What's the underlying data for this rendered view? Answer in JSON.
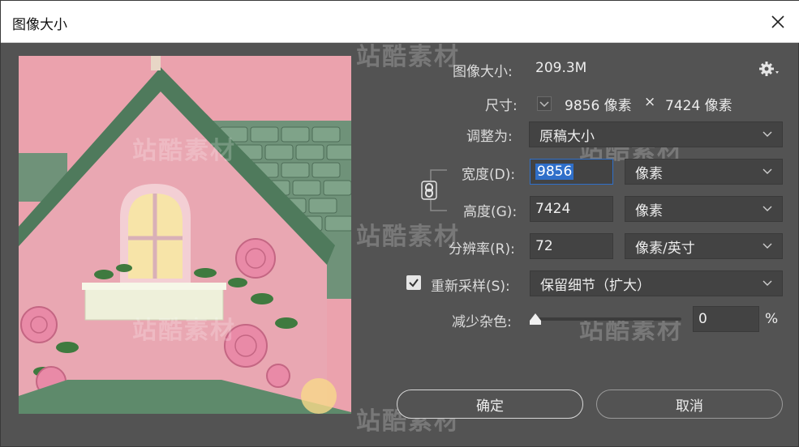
{
  "window": {
    "title": "图像大小"
  },
  "image_size": {
    "label": "图像大小:",
    "value": "209.3M"
  },
  "dimensions": {
    "label": "尺寸:",
    "width": "9856 像素",
    "times": "×",
    "height": "7424 像素"
  },
  "fit_to": {
    "label": "调整为:",
    "value": "原稿大小"
  },
  "width": {
    "label": "宽度(D):",
    "value": "9856",
    "unit": "像素"
  },
  "height": {
    "label": "高度(G):",
    "value": "7424",
    "unit": "像素"
  },
  "resolution": {
    "label": "分辨率(R):",
    "value": "72",
    "unit": "像素/英寸"
  },
  "resample": {
    "label": "重新采样(S):",
    "checked": true,
    "value": "保留细节（扩大）"
  },
  "noise": {
    "label": "减少杂色:",
    "value": "0",
    "unit": "%",
    "level": 0
  },
  "buttons": {
    "ok": "确定",
    "cancel": "取消"
  },
  "watermark": {
    "text": "站酷素材"
  },
  "colors": {
    "dialog_bg": "#535353",
    "field_bg": "#434343",
    "focus": "#2f6fc9",
    "title_bg": "#ffffff"
  }
}
